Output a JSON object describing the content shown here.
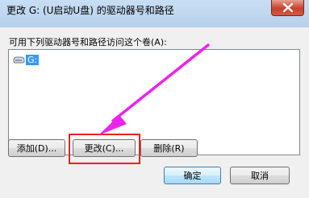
{
  "window": {
    "title": "更改 G: (U启动U盘) 的驱动器号和路径",
    "close_icon": "close-icon"
  },
  "dialog": {
    "prompt": "可用下列驱动器号和路径访问这个卷(A):",
    "list_items": [
      {
        "label": "G:",
        "icon": "drive-icon",
        "selected": true
      }
    ],
    "buttons": {
      "add": "添加(D)...",
      "change": "更改(C)...",
      "remove": "删除(R)",
      "ok": "确定",
      "cancel": "取消"
    }
  },
  "annotation": {
    "highlight_color": "#e8221c",
    "arrow_color": "#ee22ee"
  }
}
